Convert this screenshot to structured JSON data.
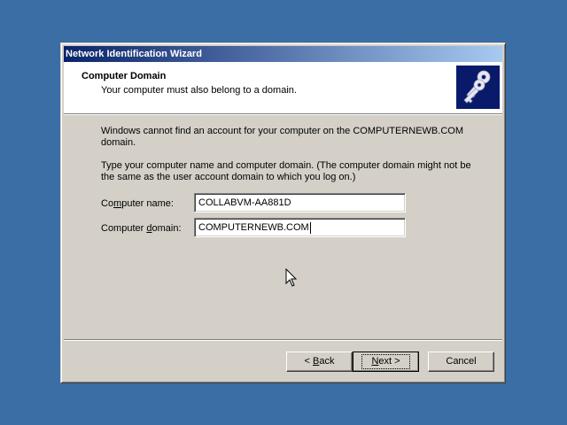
{
  "window": {
    "title": "Network Identification Wizard"
  },
  "header": {
    "title": "Computer Domain",
    "subtitle": "Your computer must also belong to a domain.",
    "icon": "keys-icon"
  },
  "body": {
    "paragraph1": "Windows cannot find an account for your computer on the COMPUTERNEWB.COM domain.",
    "paragraph2": "Type your computer name and computer domain. (The computer domain might not be the same as the user account domain to which you log on.)"
  },
  "form": {
    "computer_name_label_pre": "Co",
    "computer_name_label_key": "m",
    "computer_name_label_post": "puter name:",
    "computer_name_value": "COLLABVM-AA881D",
    "computer_domain_label_pre": "Computer ",
    "computer_domain_label_key": "d",
    "computer_domain_label_post": "omain:",
    "computer_domain_value": "COMPUTERNEWB.COM"
  },
  "buttons": {
    "back_pre": "< ",
    "back_key": "B",
    "back_post": "ack",
    "next_key": "N",
    "next_post": "ext >",
    "cancel": "Cancel"
  },
  "colors": {
    "desktop": "#3a6ea5",
    "titlebar_start": "#0a246a",
    "titlebar_end": "#a6caf0",
    "dialog_face": "#d4d0c8"
  }
}
